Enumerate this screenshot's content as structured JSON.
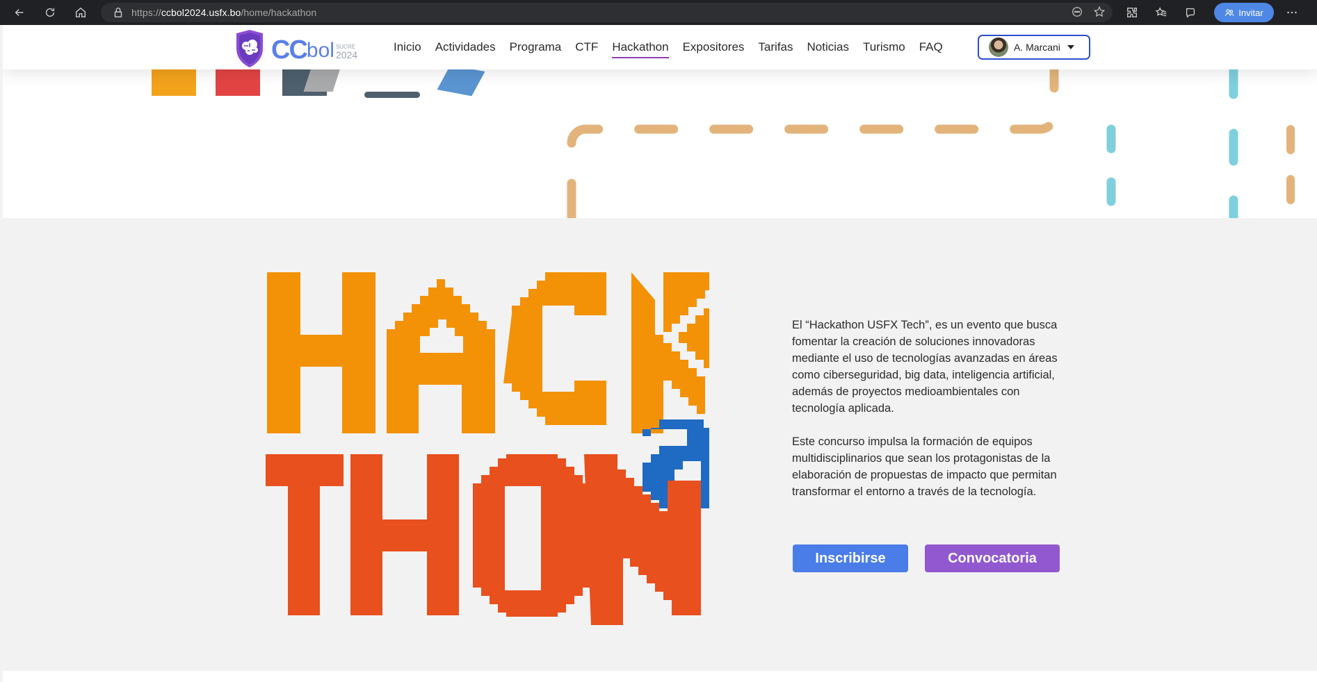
{
  "browser": {
    "url_scheme": "https://",
    "url_host": "ccbol2024.usfx.bo",
    "url_path": "/home/hackathon",
    "invite_label": "Invitar"
  },
  "brand": {
    "cc": "CC",
    "bol": "bol",
    "sucre": "SUCRE",
    "year": "2024"
  },
  "nav": {
    "items": [
      {
        "label": "Inicio"
      },
      {
        "label": "Actividades"
      },
      {
        "label": "Programa"
      },
      {
        "label": "CTF"
      },
      {
        "label": "Hackathon"
      },
      {
        "label": "Expositores"
      },
      {
        "label": "Tarifas"
      },
      {
        "label": "Noticias"
      },
      {
        "label": "Turismo"
      },
      {
        "label": "FAQ"
      }
    ],
    "active": "Hackathon",
    "user_name": "A. Marcani"
  },
  "hackathon": {
    "logo_line1": "HACK",
    "logo_middle": "a",
    "logo_line2": "THON",
    "paragraph1": "El “Hackathon USFX Tech”, es un evento que busca fomentar la creación de soluciones innovadoras mediante el uso de tecnologías avanzadas en áreas como ciberseguridad, big data, inteligencia artificial, además de proyectos medioambientales con tecnología aplicada.",
    "paragraph2": "Este concurso impulsa la formación de equipos multidisciplinarios que sean los protagonistas de la elaboración de propuestas de impacto que permitan transformar el entorno a través de la tecnología.",
    "btn_inscribirse": "Inscribirse",
    "btn_convocatoria": "Convocatoria"
  },
  "colors": {
    "orange": "#f39207",
    "red_orange": "#e8501e",
    "blue": "#1f6ac2",
    "btn_blue": "#4a7de8",
    "btn_purple": "#9158cf",
    "dash_tan": "#e2b47c",
    "dash_cyan": "#7fcfdc"
  }
}
